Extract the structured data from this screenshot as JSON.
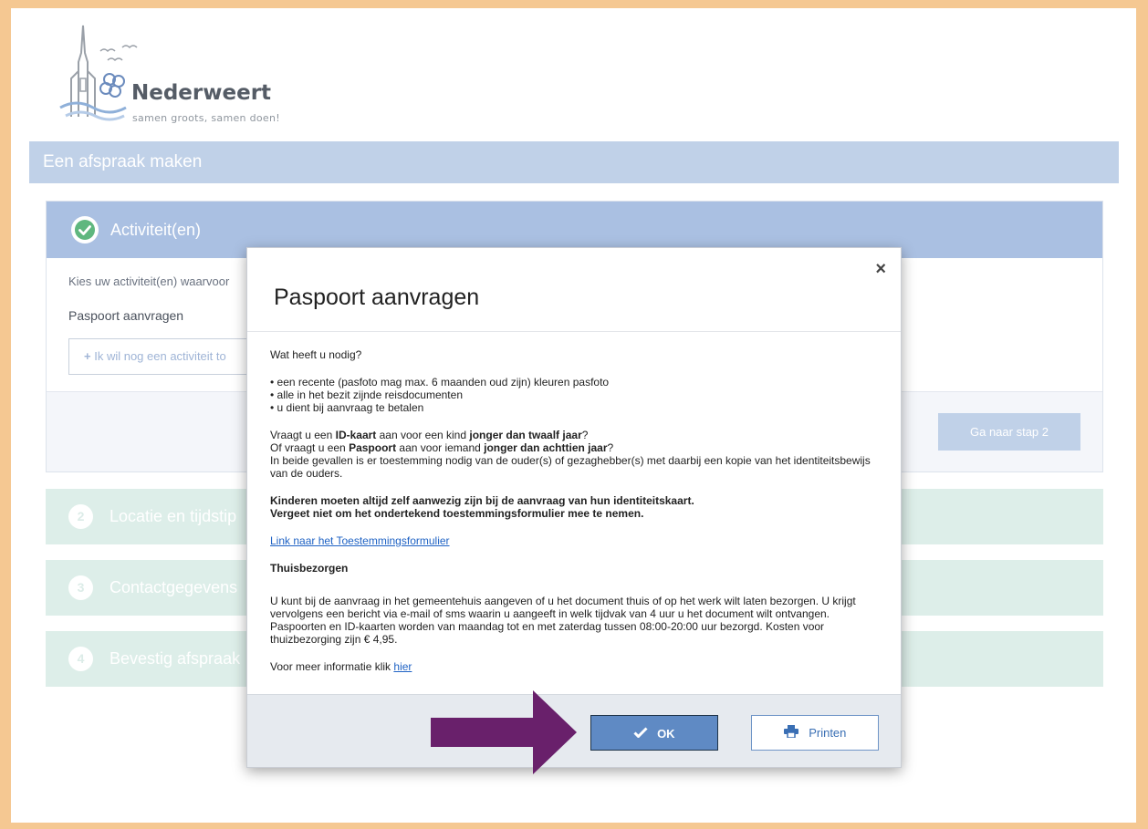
{
  "brand": {
    "name": "Nederweert",
    "tagline": "samen groots, samen doen!"
  },
  "header": {
    "title": "Een afspraak maken"
  },
  "step1": {
    "title": "Activiteit(en)",
    "intro": "Kies uw activiteit(en) waarvoor",
    "selected_activity": "Paspoort aanvragen",
    "add_label": "Ik wil nog een activiteit to",
    "next_label": "Ga naar stap 2"
  },
  "steps": [
    {
      "num": "2",
      "label": "Locatie en tijdstip"
    },
    {
      "num": "3",
      "label": "Contactgegevens"
    },
    {
      "num": "4",
      "label": "Bevestig afspraak"
    }
  ],
  "modal": {
    "title": "Paspoort aanvragen",
    "close_symbol": "×",
    "need_heading": "Wat heeft u nodig?",
    "need_items": [
      "• een recente (pasfoto mag max. 6 maanden oud zijn) kleuren pasfoto",
      "• alle in het bezit zijnde reisdocumenten",
      "• u dient bij aanvraag te betalen"
    ],
    "consent": {
      "l1_a": "Vraagt u een ",
      "l1_b": "ID-kaart",
      "l1_c": " aan voor een kind ",
      "l1_d": "jonger dan twaalf jaar",
      "l1_e": "?",
      "l2_a": "Of vraagt u een ",
      "l2_b": "Paspoort",
      "l2_c": " aan voor iemand ",
      "l2_d": "jonger dan achttien jaar",
      "l2_e": "?",
      "l3": "In beide gevallen is er toestemming nodig van de ouder(s) of gezaghebber(s) met daarbij een kopie van het identiteitsbewijs van de ouders."
    },
    "warning_1": "Kinderen moeten altijd zelf aanwezig zijn bij de aanvraag van hun identiteitskaart.",
    "warning_2": "Vergeet niet om het ondertekend toestemmingsformulier mee te nemen.",
    "form_link": "Link naar het Toestemmingsformulier",
    "home_delivery_heading": "Thuisbezorgen",
    "home_delivery_text": "U kunt bij de aanvraag in het gemeentehuis aangeven of u het document thuis of op het werk wilt laten bezorgen. U krijgt vervolgens een bericht via e-mail of sms waarin u aangeeft in welk tijdvak van 4 uur u het document wilt ontvangen. Paspoorten en ID-kaarten worden van maandag tot en met zaterdag tussen 08:00-20:00 uur bezorgd. Kosten voor thuizbezorging zijn € 4,95.",
    "more_info_text": "Voor meer informatie klik ",
    "more_info_link": "hier",
    "ok_label": "OK",
    "print_label": "Printen"
  },
  "colors": {
    "frame": "#f5c892",
    "header": "#c0d1e8",
    "step_pending": "#ddeee9",
    "ok_button": "#5f8ac4",
    "arrow": "#69206b",
    "link": "#1e62c4"
  }
}
